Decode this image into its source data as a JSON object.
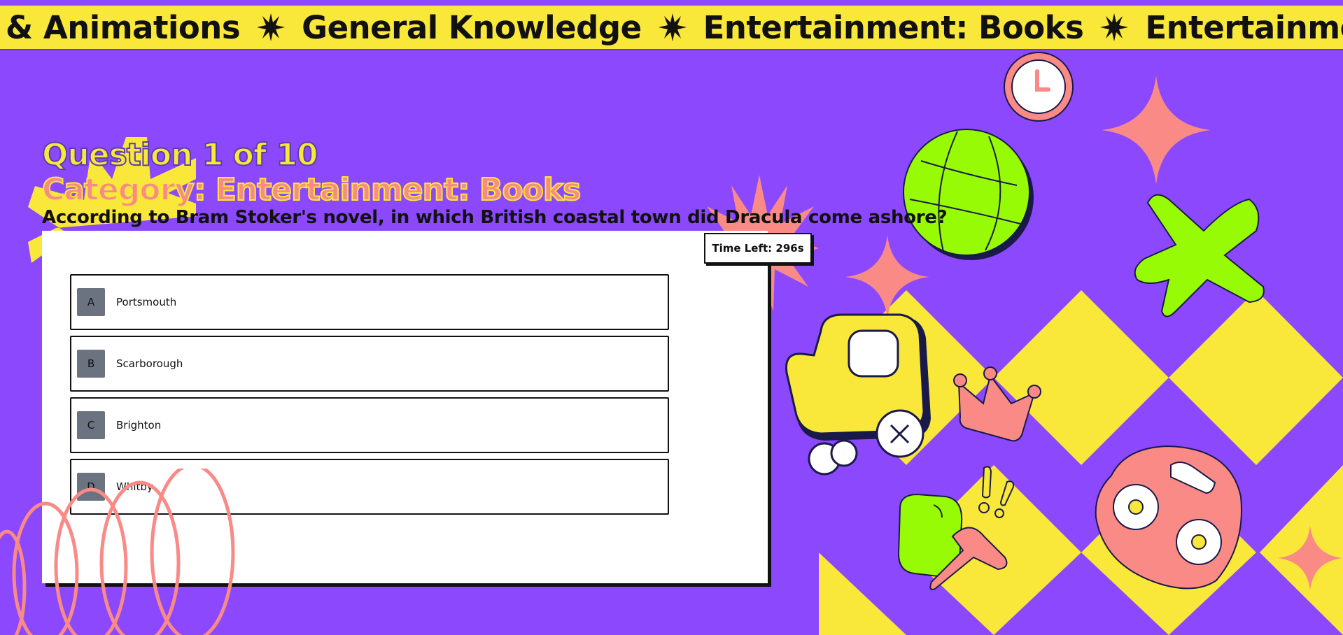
{
  "marquee": {
    "items": [
      "& Animations",
      "General Knowledge",
      "Entertainment: Books",
      "Entertainment: Film"
    ]
  },
  "quiz": {
    "question_counter": "Question 1 of 10",
    "category": "Category: Entertainment: Books",
    "question": "According to Bram Stoker's novel, in which British coastal town did Dracula come ashore?",
    "timer": "Time Left: 296s",
    "answers": [
      {
        "letter": "A",
        "text": "Portsmouth"
      },
      {
        "letter": "B",
        "text": "Scarborough"
      },
      {
        "letter": "C",
        "text": "Brighton"
      },
      {
        "letter": "D",
        "text": "Whitby"
      }
    ]
  },
  "colors": {
    "background": "#8b48fd",
    "marquee": "#f9e73a",
    "accent_pink": "#f98a86",
    "accent_green": "#98fb06",
    "accent_yellow": "#f9e73a",
    "letter_badge": "#6b7280"
  },
  "decorations": [
    "clock-icon",
    "globe-icon",
    "airplane-icon",
    "train-icon",
    "crown-icon",
    "camera-icon",
    "ice-cream-icon",
    "exclamation-icon",
    "sparkle-icon",
    "starburst-icon",
    "loops-decoration",
    "diamond-pattern"
  ]
}
